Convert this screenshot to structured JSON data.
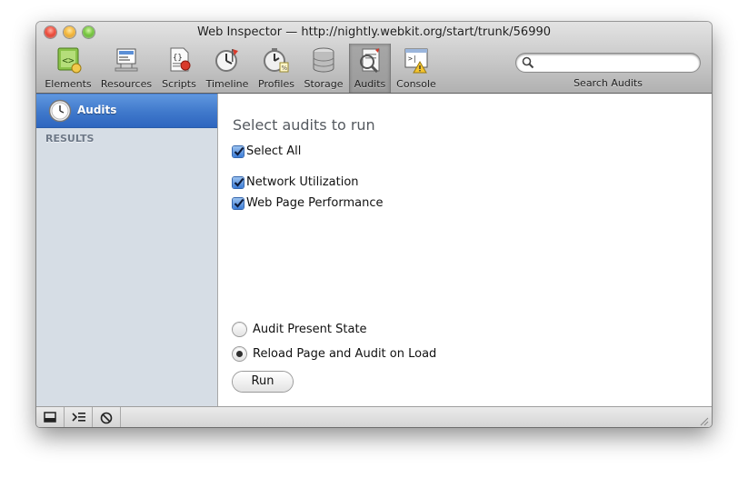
{
  "window": {
    "title": "Web Inspector — http://nightly.webkit.org/start/trunk/56990"
  },
  "toolbar": {
    "items": [
      {
        "label": "Elements"
      },
      {
        "label": "Resources"
      },
      {
        "label": "Scripts"
      },
      {
        "label": "Timeline"
      },
      {
        "label": "Profiles"
      },
      {
        "label": "Storage"
      },
      {
        "label": "Audits",
        "selected": true
      },
      {
        "label": "Console"
      }
    ],
    "search_value": "",
    "search_label": "Search Audits"
  },
  "sidebar": {
    "selected_item": "Audits",
    "section_label": "RESULTS"
  },
  "main": {
    "heading": "Select audits to run",
    "select_all": {
      "label": "Select All",
      "checked": true
    },
    "audits": [
      {
        "label": "Network Utilization",
        "checked": true
      },
      {
        "label": "Web Page Performance",
        "checked": true
      }
    ],
    "modes": [
      {
        "label": "Audit Present State",
        "selected": false
      },
      {
        "label": "Reload Page and Audit on Load",
        "selected": true
      }
    ],
    "run_label": "Run"
  },
  "statusbar": {
    "buttons": [
      "dock-icon",
      "console-icon",
      "clear-icon"
    ]
  },
  "colors": {
    "selection_blue": "#3f78cb",
    "sidebar_bg": "#d6dde5",
    "toolbar_gradient_top": "#e3e3e3",
    "toolbar_gradient_bottom": "#b1b1b1"
  }
}
